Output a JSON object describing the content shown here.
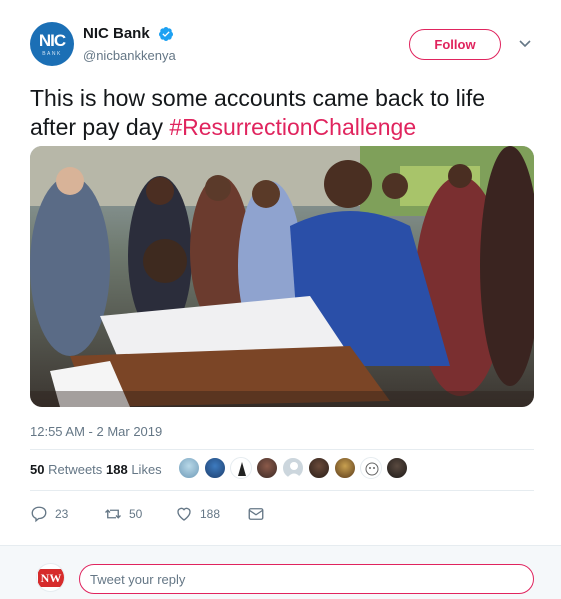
{
  "tweet": {
    "author": {
      "display_name": "NIC Bank",
      "handle": "@nicbankkenya",
      "avatar_text": "NIC",
      "avatar_subtext": "BANK",
      "verified": true
    },
    "follow_label": "Follow",
    "text": "This is how some accounts came back to life after pay day ",
    "hashtag": "#ResurrectionChallenge",
    "timestamp": "12:55 AM - 2 Mar 2019",
    "stats": {
      "retweets_count": "50",
      "retweets_label": "Retweets",
      "likes_count": "188",
      "likes_label": "Likes"
    },
    "actions": {
      "reply_count": "23",
      "retweet_count": "50",
      "like_count": "188"
    }
  },
  "reply_bar": {
    "avatar_text": "NW",
    "placeholder": "Tweet your reply"
  },
  "colors": {
    "accent": "#e0245e",
    "verified": "#1da1f2",
    "brand_blue": "#1b6fb5",
    "muted": "#657786"
  }
}
